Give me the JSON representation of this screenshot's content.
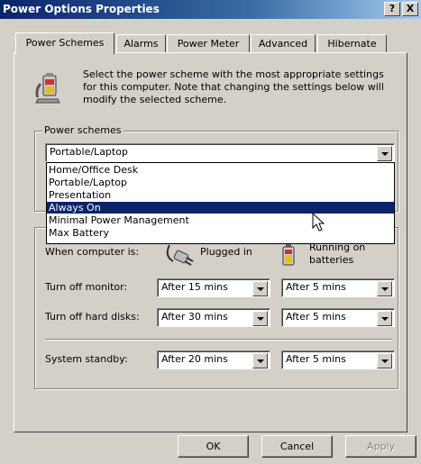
{
  "window": {
    "title": "Power Options Properties",
    "help_label": "?",
    "close_label": "X"
  },
  "tabs": [
    {
      "label": "Power Schemes"
    },
    {
      "label": "Alarms"
    },
    {
      "label": "Power Meter"
    },
    {
      "label": "Advanced"
    },
    {
      "label": "Hibernate"
    }
  ],
  "description": "Select the power scheme with the most appropriate settings for this computer. Note that changing the settings below will modify the selected scheme.",
  "schemes": {
    "group_label": "Power schemes",
    "selected": "Portable/Laptop",
    "options": [
      {
        "label": "Home/Office Desk"
      },
      {
        "label": "Portable/Laptop"
      },
      {
        "label": "Presentation"
      },
      {
        "label": "Always On"
      },
      {
        "label": "Minimal Power Management"
      },
      {
        "label": "Max Battery"
      }
    ],
    "highlighted": "Always On"
  },
  "settings": {
    "when_label": "When computer is:",
    "plugged_label": "Plugged in",
    "battery_label_1": "Running on",
    "battery_label_2": "batteries",
    "rows": [
      {
        "label": "Turn off monitor:",
        "plugged": "After 15 mins",
        "battery": "After 5 mins"
      },
      {
        "label": "Turn off hard disks:",
        "plugged": "After 30 mins",
        "battery": "After 5 mins"
      },
      {
        "label": "System standby:",
        "plugged": "After 20 mins",
        "battery": "After 5 mins"
      }
    ]
  },
  "buttons": {
    "ok": "OK",
    "cancel": "Cancel",
    "apply": "Apply"
  },
  "colors": {
    "title_bar": "#0a246a",
    "selection": "#0a246a",
    "face": "#d4d0c8"
  }
}
